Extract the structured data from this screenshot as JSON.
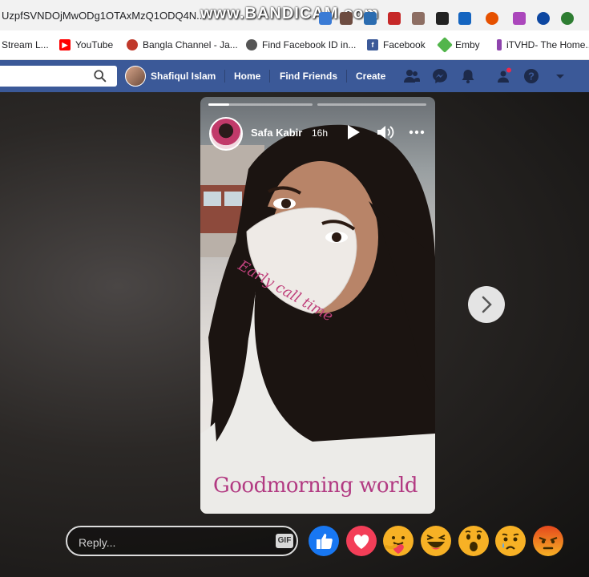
{
  "browser": {
    "url": "UzpfSVNDOjMwODg1OTAxMzQ1ODQ4N...",
    "watermark": "www.BANDICAM.com",
    "bookmarks": [
      {
        "label": "Stream L...",
        "color": "#1a73e8"
      },
      {
        "label": "YouTube",
        "color": "#ff0000"
      },
      {
        "label": "Bangla Channel - Ja...",
        "color": "#c0392b"
      },
      {
        "label": "Find Facebook ID in...",
        "color": "#555555"
      },
      {
        "label": "Facebook",
        "color": "#3b5998"
      },
      {
        "label": "Emby",
        "color": "#52b54b"
      },
      {
        "label": "iTVHD- The Home...",
        "color": "#8e44ad"
      }
    ]
  },
  "fb": {
    "user_name": "Shafiqul Islam",
    "nav": [
      "Home",
      "Find Friends",
      "Create"
    ]
  },
  "story": {
    "author": "Safa Kabir",
    "time": "16h",
    "caption_top": "Early call time",
    "caption_bottom": "Goodmorning world"
  },
  "reply": {
    "placeholder": "Reply...",
    "gif_label": "GIF"
  },
  "reactions": [
    "like-reaction",
    "love-reaction",
    "care-reaction",
    "haha-reaction",
    "wow-reaction",
    "sad-reaction",
    "angry-reaction"
  ],
  "colors": {
    "fb_blue": "#3b5998",
    "caption_pink": "#b23a82"
  }
}
